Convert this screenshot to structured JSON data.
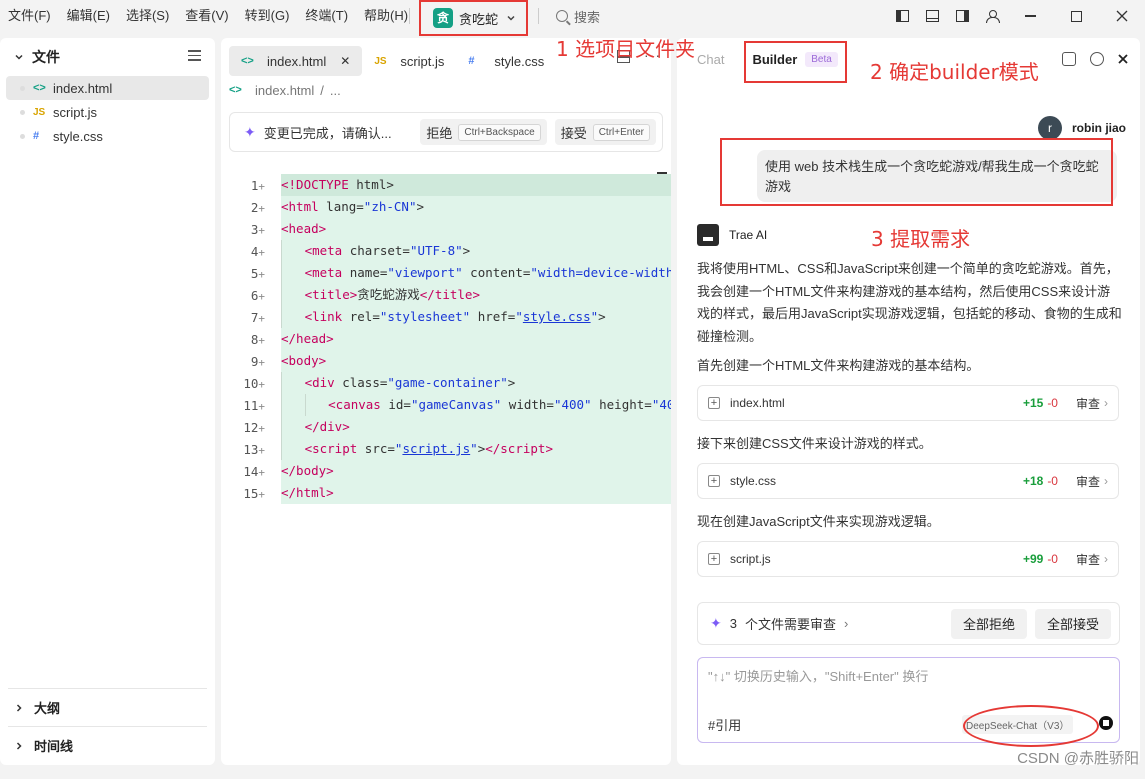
{
  "menubar": {
    "items": [
      "文件(F)",
      "编辑(E)",
      "选择(S)",
      "查看(V)",
      "转到(G)",
      "终端(T)",
      "帮助(H)"
    ],
    "project_logo": "贪",
    "project_name": "贪吃蛇",
    "search_placeholder": "搜索"
  },
  "sidebar": {
    "title": "文件",
    "files": [
      {
        "ext": "<>",
        "name": "index.html"
      },
      {
        "ext": "JS",
        "name": "script.js"
      },
      {
        "ext": "#",
        "name": "style.css"
      }
    ],
    "outline_label": "大纲",
    "timeline_label": "时间线"
  },
  "editor": {
    "tabs": [
      {
        "icon": "<>",
        "label": "index.html",
        "close": "✕"
      },
      {
        "icon": "JS",
        "label": "script.js"
      },
      {
        "icon": "#",
        "label": "style.css"
      }
    ],
    "breadcrumb": {
      "icon": "<>",
      "file": "index.html",
      "sep": "/",
      "rest": "..."
    },
    "review_bar": {
      "text": "变更已完成，请确认...",
      "reject_label": "拒绝",
      "reject_kbd": "Ctrl+Backspace",
      "accept_label": "接受",
      "accept_kbd": "Ctrl+Enter"
    },
    "line_numbers": [
      "1",
      "2",
      "3",
      "4",
      "5",
      "6",
      "7",
      "8",
      "9",
      "10",
      "11",
      "12",
      "13",
      "14",
      "15"
    ],
    "plus": "+"
  },
  "chat": {
    "tab_chat": "Chat",
    "tab_builder": "Builder",
    "beta": "Beta",
    "user_name": "robin jiao",
    "user_initial": "r",
    "user_message": "使用 web 技术栈生成一个贪吃蛇游戏/帮我生成一个贪吃蛇游戏",
    "ai_name": "Trae AI",
    "ai_intro": "我将使用HTML、CSS和JavaScript来创建一个简单的贪吃蛇游戏。首先，我会创建一个HTML文件来构建游戏的基本结构，然后使用CSS来设计游戏的样式，最后用JavaScript实现游戏逻辑，包括蛇的移动、食物的生成和碰撞检测。",
    "steps": [
      {
        "text": "首先创建一个HTML文件来构建游戏的基本结构。",
        "file": "index.html",
        "added": "+15",
        "removed": "-0",
        "review": "审查"
      },
      {
        "text": "接下来创建CSS文件来设计游戏的样式。",
        "file": "style.css",
        "added": "+18",
        "removed": "-0",
        "review": "审查"
      },
      {
        "text": "现在创建JavaScript文件来实现游戏逻辑。",
        "file": "script.js",
        "added": "+99",
        "removed": "-0",
        "review": "审查"
      }
    ],
    "pending": {
      "count": "3",
      "text": "个文件需要审查",
      "reject_all": "全部拒绝",
      "accept_all": "全部接受"
    },
    "input": {
      "placeholder": "\"↑↓\" 切换历史输入，\"Shift+Enter\" 换行",
      "ref": "#引用",
      "model": "DeepSeek-Chat（V3）"
    }
  },
  "annotations": {
    "a1": "1 选项目文件夹",
    "a2": "2 确定builder模式",
    "a3": "3 提取需求"
  },
  "watermark": "CSDN @赤胜骄阳"
}
